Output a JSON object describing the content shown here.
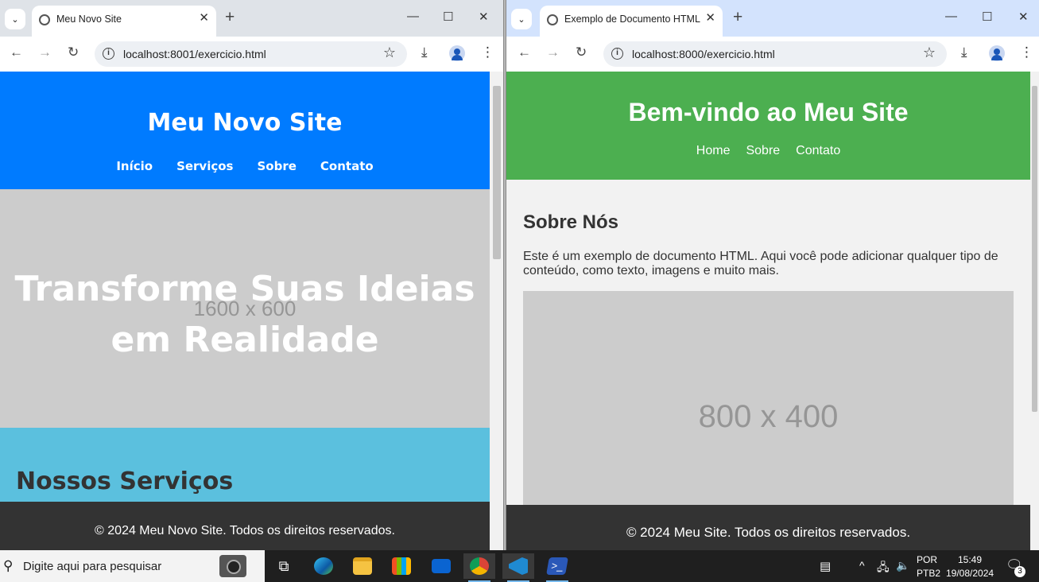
{
  "left_window": {
    "tab_title": "Meu Novo Site",
    "url": "localhost:8001/exercicio.html",
    "page": {
      "site_title": "Meu Novo Site",
      "nav": [
        "Início",
        "Serviços",
        "Sobre",
        "Contato"
      ],
      "hero_placeholder": "1600 x 600",
      "hero_title": "Transforme Suas Ideias em Realidade",
      "services_heading": "Nossos Serviços",
      "footer": "© 2024 Meu Novo Site. Todos os direitos reservados.",
      "colors": {
        "header": "#007bff",
        "hero": "#cccccc",
        "services": "#5bc0de",
        "footer": "#333333"
      }
    }
  },
  "right_window": {
    "tab_title": "Exemplo de Documento HTML",
    "url": "localhost:8000/exercicio.html",
    "page": {
      "site_title": "Bem-vindo ao Meu Site",
      "nav": [
        "Home",
        "Sobre",
        "Contato"
      ],
      "about_heading": "Sobre Nós",
      "about_text": "Este é um exemplo de documento HTML. Aqui você pode adicionar qualquer tipo de conteúdo, como texto, imagens e muito mais.",
      "image_placeholder": "800 x 400",
      "footer": "© 2024 Meu Site. Todos os direitos reservados.",
      "colors": {
        "header": "#4caf50",
        "main": "#f2f2f2",
        "footer": "#333333"
      }
    }
  },
  "taskbar": {
    "search_placeholder": "Digite aqui para pesquisar",
    "apps": [
      "task-view",
      "edge",
      "file-explorer",
      "store",
      "mail",
      "chrome",
      "vscode",
      "powershell"
    ],
    "language": "POR",
    "keyboard": "PTB2",
    "time": "15:49",
    "date": "19/08/2024",
    "notification_count": "3"
  }
}
